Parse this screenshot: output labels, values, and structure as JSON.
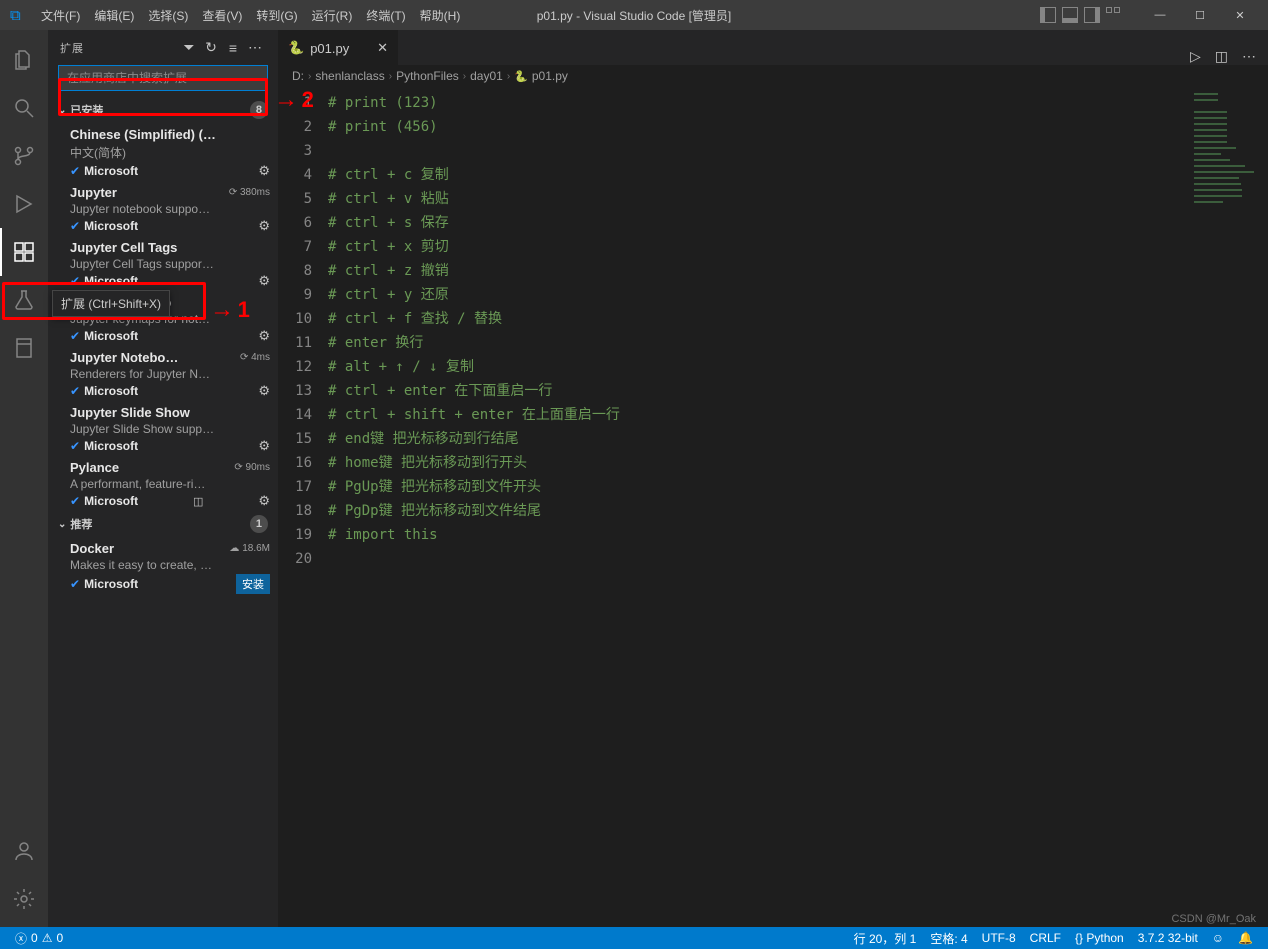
{
  "titlebar": {
    "menu": [
      "文件(F)",
      "编辑(E)",
      "选择(S)",
      "查看(V)",
      "转到(G)",
      "运行(R)",
      "终端(T)",
      "帮助(H)"
    ],
    "title": "p01.py - Visual Studio Code [管理员]",
    "win_min": "—",
    "win_max": "☐",
    "win_close": "✕"
  },
  "sidebar": {
    "title": "扩展",
    "search_placeholder": "在应用商店中搜索扩展",
    "sections": {
      "installed": {
        "label": "已安装",
        "count": "8"
      },
      "recommended": {
        "label": "推荐",
        "count": "1"
      }
    },
    "installed_exts": [
      {
        "name": "Chinese (Simplified) (…",
        "desc": "中文(简体)",
        "publisher": "Microsoft",
        "meta": ""
      },
      {
        "name": "Jupyter",
        "desc": "Jupyter notebook suppo…",
        "publisher": "Microsoft",
        "meta": "⟳ 380ms"
      },
      {
        "name": "Jupyter Cell Tags",
        "desc": "Jupyter Cell Tags suppor…",
        "publisher": "Microsoft",
        "meta": ""
      },
      {
        "name": "Jupyter Keymap",
        "desc": "Jupyter keymaps for not…",
        "publisher": "Microsoft",
        "meta": ""
      },
      {
        "name": "Jupyter Notebo…",
        "desc": "Renderers for Jupyter N…",
        "publisher": "Microsoft",
        "meta": "⟳ 4ms"
      },
      {
        "name": "Jupyter Slide Show",
        "desc": "Jupyter Slide Show supp…",
        "publisher": "Microsoft",
        "meta": ""
      },
      {
        "name": "Pylance",
        "desc": "A performant, feature-ri…",
        "publisher": "Microsoft",
        "meta": "⟳ 90ms",
        "split": true
      }
    ],
    "recommended_exts": [
      {
        "name": "Docker",
        "desc": "Makes it easy to create, …",
        "publisher": "Microsoft",
        "meta": "☁ 18.6M",
        "install": "安装"
      }
    ]
  },
  "tooltip": {
    "text": "扩展 (Ctrl+Shift+X)"
  },
  "tab": {
    "filename": "p01.py",
    "close": "✕"
  },
  "breadcrumb": [
    "D:",
    "shenlanclass",
    "PythonFiles",
    "day01",
    "p01.py"
  ],
  "code_lines": [
    "# print (123)",
    "# print (456)",
    "",
    "# ctrl + c 复制",
    "# ctrl + v 粘贴",
    "# ctrl + s 保存",
    "# ctrl + x 剪切",
    "# ctrl + z 撤销",
    "# ctrl + y 还原",
    "# ctrl + f 查找 / 替换",
    "# enter 换行",
    "# alt + ↑ / ↓ 复制",
    "# ctrl + enter 在下面重启一行",
    "# ctrl + shift + enter 在上面重启一行",
    "# end键 把光标移动到行结尾",
    "# home键 把光标移动到行开头",
    "# PgUp键 把光标移动到文件开头",
    "# PgDp键 把光标移动到文件结尾",
    "# import this",
    ""
  ],
  "statusbar": {
    "errors": "0",
    "warnings": "0",
    "cursor": "行 20，列 1",
    "spaces": "空格: 4",
    "encoding": "UTF-8",
    "eol": "CRLF",
    "lang": "{} Python",
    "interpreter": "3.7.2 32-bit",
    "feedback": "☺",
    "notif": "🔔"
  },
  "watermark": "CSDN @Mr_Oak",
  "annotations": {
    "num1": "1",
    "num2": "2"
  }
}
